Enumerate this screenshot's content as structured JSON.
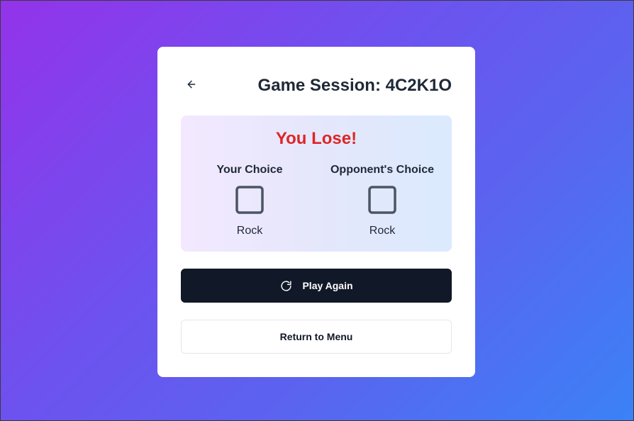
{
  "header": {
    "back_icon": "arrow-left-icon",
    "title": "Game Session: 4C2K1O"
  },
  "result": {
    "text": "You Lose!",
    "color": "#dc2626",
    "your_choice": {
      "label": "Your Choice",
      "icon": "square-icon",
      "value": "Rock"
    },
    "opponent_choice": {
      "label": "Opponent's Choice",
      "icon": "square-icon",
      "value": "Rock"
    }
  },
  "actions": {
    "play_again_icon": "rotate-cw-icon",
    "play_again_label": "Play Again",
    "return_label": "Return to Menu"
  },
  "colors": {
    "primary_button": "#111827",
    "background_gradient_start": "#9333ea",
    "background_gradient_end": "#3b82f6"
  }
}
